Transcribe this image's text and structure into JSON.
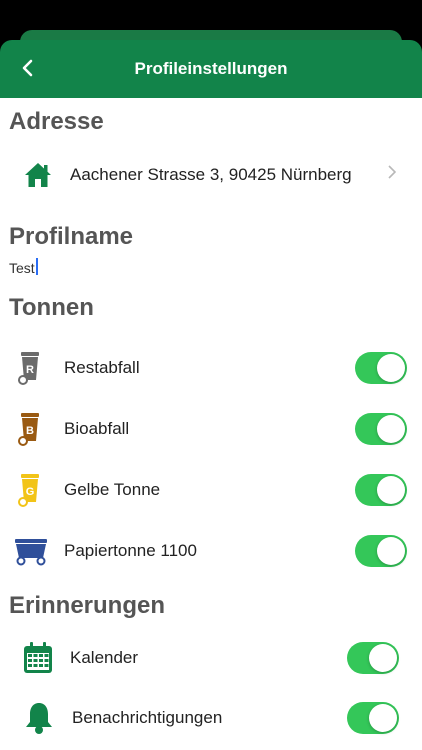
{
  "header": {
    "title": "Profileinstellungen"
  },
  "address": {
    "section_title": "Adresse",
    "value": "Aachener Strasse 3, 90425 Nürnberg"
  },
  "profile": {
    "section_title": "Profilname",
    "name_value": "Test"
  },
  "bins": {
    "section_title": "Tonnen",
    "items": [
      {
        "label": "Restabfall",
        "letter": "R",
        "color": "#6b6b6b",
        "enabled": true,
        "icon": "residual-bin-icon"
      },
      {
        "label": "Bioabfall",
        "letter": "B",
        "color": "#9a5a12",
        "enabled": true,
        "icon": "organic-bin-icon"
      },
      {
        "label": "Gelbe Tonne",
        "letter": "G",
        "color": "#f2c418",
        "enabled": true,
        "icon": "yellow-bin-icon"
      },
      {
        "label": "Papiertonne 1100",
        "letter": "",
        "color": "#2f4f9a",
        "enabled": true,
        "icon": "paper-container-icon"
      }
    ]
  },
  "reminders": {
    "section_title": "Erinnerungen",
    "items": [
      {
        "label": "Kalender",
        "enabled": true,
        "icon": "calendar-icon"
      },
      {
        "label": "Benachrichtigungen",
        "enabled": true,
        "icon": "bell-icon"
      }
    ]
  },
  "colors": {
    "brand": "#12844a",
    "toggle_on": "#34c759",
    "section_title": "#555555"
  }
}
